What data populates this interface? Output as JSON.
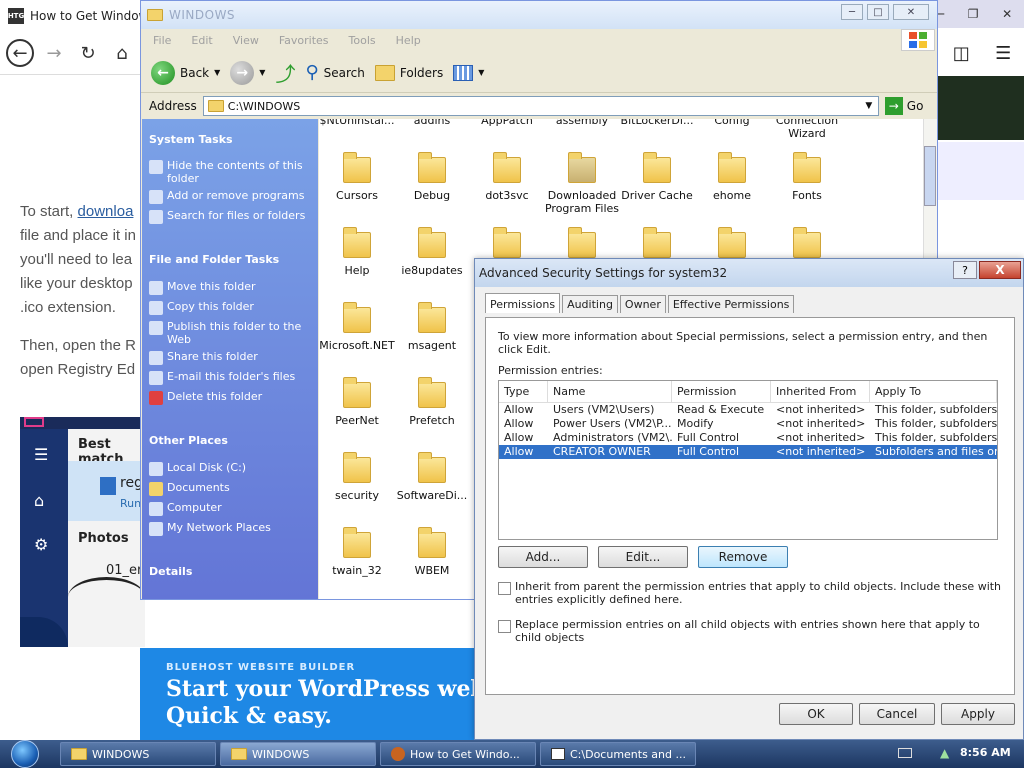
{
  "browser": {
    "tab_title": "How to Get Windows",
    "favicon_text": "HTG",
    "article": {
      "p1_link": "downloa",
      "p1_prefix": "To start, ",
      "p1_lines": [
        "file and place it in",
        "you'll need to lea",
        "like your desktop",
        ".ico extension."
      ],
      "p2_lines": [
        "Then, open the R",
        "open Registry Ed"
      ]
    },
    "search_panel": {
      "best_match": "Best match",
      "result_title": "reg",
      "result_sub": "Run",
      "photos": "Photos",
      "photo_item": "01_er"
    }
  },
  "ad": {
    "small": "BLUEHOST WEBSITE BUILDER",
    "line1": "Start your WordPress websi",
    "line2": "Quick & easy."
  },
  "explorer": {
    "title": "WINDOWS",
    "menu": [
      "File",
      "Edit",
      "View",
      "Favorites",
      "Tools",
      "Help"
    ],
    "toolbar": {
      "back": "Back",
      "search": "Search",
      "folders": "Folders"
    },
    "address_label": "Address",
    "address_value": "C:\\WINDOWS",
    "go": "Go",
    "system_tasks": {
      "header": "System Tasks",
      "items": [
        "Hide the contents of this folder",
        "Add or remove programs",
        "Search for files or folders"
      ]
    },
    "file_folder_tasks": {
      "header": "File and Folder Tasks",
      "items": [
        "Move this folder",
        "Copy this folder",
        "Publish this folder to the Web",
        "Share this folder",
        "E-mail this folder's files",
        "Delete this folder"
      ]
    },
    "other_places": {
      "header": "Other Places",
      "items": [
        "Local Disk (C:)",
        "Documents",
        "Computer",
        "My Network Places"
      ]
    },
    "details_header": "Details",
    "folders": [
      "$NtUninstal...",
      "addins",
      "AppPatch",
      "assembly",
      "BitLockerDi...",
      "Config",
      "Connection Wizard",
      "Cursors",
      "Debug",
      "dot3svc",
      "Downloaded Program Files",
      "Driver Cache",
      "ehome",
      "Fonts",
      "Help",
      "ie8updates",
      "",
      "",
      "",
      "",
      "",
      "Microsoft.NET",
      "msagent",
      "PeerNet",
      "Prefetch",
      "security",
      "SoftwareDi...",
      "twain_32",
      "WBEM"
    ]
  },
  "security_dialog": {
    "title": "Advanced Security Settings for system32",
    "tabs": [
      "Permissions",
      "Auditing",
      "Owner",
      "Effective Permissions"
    ],
    "info": "To view more information about Special permissions, select a permission entry, and then click Edit.",
    "entries_label": "Permission entries:",
    "columns": [
      "Type",
      "Name",
      "Permission",
      "Inherited From",
      "Apply To"
    ],
    "rows": [
      [
        "Allow",
        "Users (VM2\\Users)",
        "Read & Execute",
        "<not inherited>",
        "This folder, subfolders..."
      ],
      [
        "Allow",
        "Power Users (VM2\\P...",
        "Modify",
        "<not inherited>",
        "This folder, subfolders..."
      ],
      [
        "Allow",
        "Administrators (VM2\\...",
        "Full Control",
        "<not inherited>",
        "This folder, subfolders..."
      ],
      [
        "Allow",
        "CREATOR OWNER",
        "Full Control",
        "<not inherited>",
        "Subfolders and files only"
      ]
    ],
    "buttons": {
      "add": "Add...",
      "edit": "Edit...",
      "remove": "Remove",
      "ok": "OK",
      "cancel": "Cancel",
      "apply": "Apply"
    },
    "inherit_label": "Inherit from parent the permission entries that apply to child objects. Include these with entries explicitly defined here.",
    "replace_label": "Replace permission entries on all child objects with entries shown here that apply to child objects",
    "help_glyph": "?",
    "close_glyph": "X"
  },
  "taskbar": {
    "buttons": [
      "WINDOWS",
      "WINDOWS",
      "How to Get Windo...",
      "C:\\Documents and ..."
    ],
    "clock": "8:56 AM"
  },
  "colors": {
    "xp_task_blue": "#6375d6",
    "selection": "#3071c8",
    "ad_blue": "#1e88e5"
  }
}
